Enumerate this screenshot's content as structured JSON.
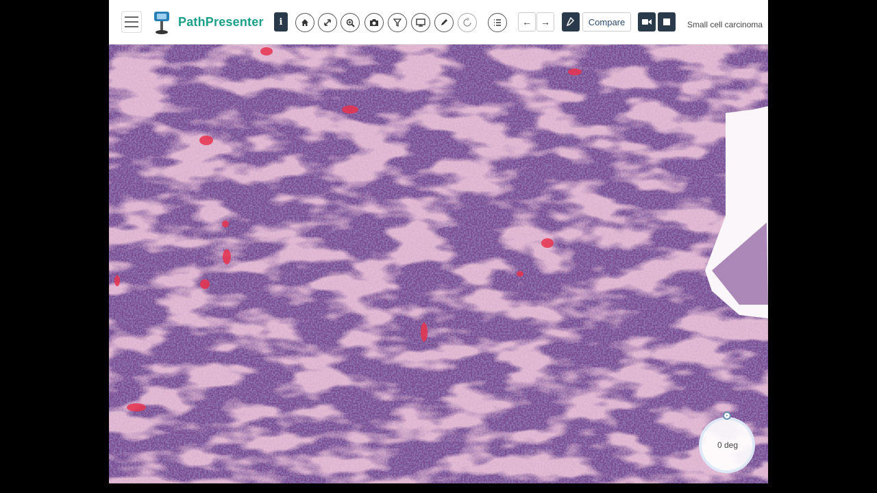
{
  "app": {
    "brand": "PathPresenter",
    "slide_title": "Small cell carcinoma",
    "compare_label": "Compare"
  },
  "toolbar_icons": [
    "info-icon",
    "home-icon",
    "fit-icon",
    "zoom-icon",
    "camera-icon",
    "filter-icon",
    "monitor-icon",
    "pencil-icon",
    "rotate-icon",
    "list-icon",
    "arrow-left-icon",
    "arrow-right-icon",
    "annotate-icon",
    "video-icon",
    "stop-icon"
  ],
  "rotation": {
    "label": "0 deg",
    "value_deg": 0
  },
  "colors": {
    "brand": "#1aa089",
    "dark_button": "#2b3a4a",
    "tissue_base": "#b06aa8",
    "tissue_dark": "#4c3272"
  }
}
